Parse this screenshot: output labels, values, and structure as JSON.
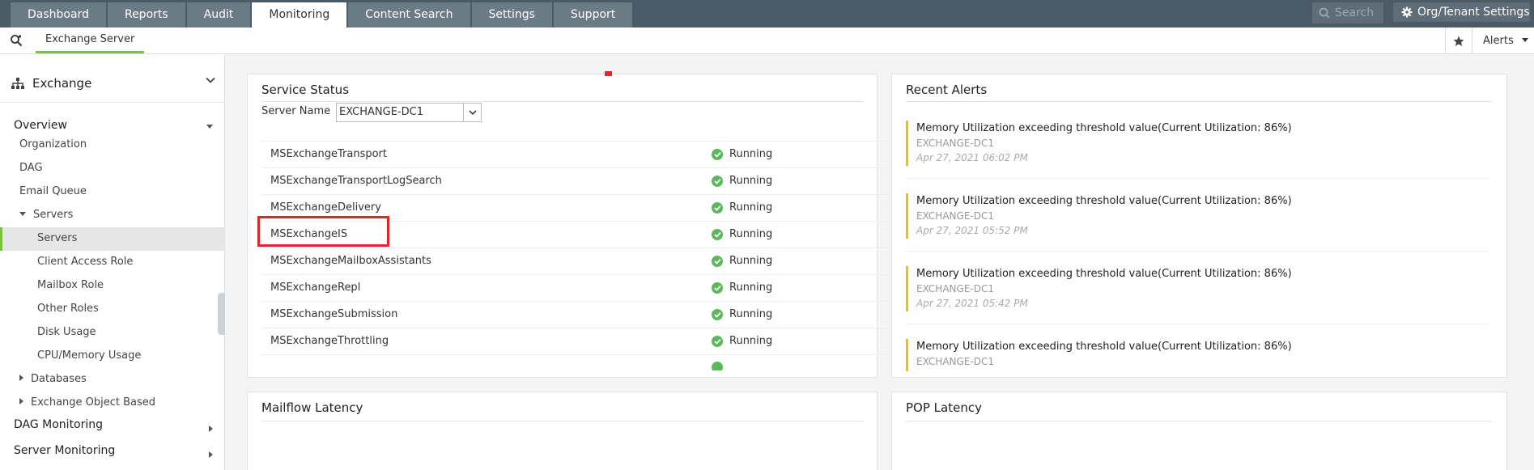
{
  "topnav": {
    "tabs": [
      "Dashboard",
      "Reports",
      "Audit",
      "Monitoring",
      "Content Search",
      "Settings",
      "Support"
    ],
    "active_tab": "Monitoring",
    "search_placeholder": "Search",
    "org_settings_label": "Org/Tenant Settings"
  },
  "subnav": {
    "tab_label": "Exchange Server",
    "alerts_label": "Alerts"
  },
  "sidebar": {
    "heading": "Exchange",
    "overview": "Overview",
    "items": {
      "organization": "Organization",
      "dag": "DAG",
      "email_queue": "Email Queue",
      "servers_group": "Servers",
      "servers": "Servers",
      "client_access_role": "Client Access Role",
      "mailbox_role": "Mailbox Role",
      "other_roles": "Other Roles",
      "disk_usage": "Disk Usage",
      "cpu_memory_usage": "CPU/Memory Usage",
      "databases": "Databases",
      "exchange_object_based": "Exchange Object Based",
      "dag_monitoring": "DAG Monitoring",
      "server_monitoring": "Server Monitoring"
    }
  },
  "service_status": {
    "title": "Service Status",
    "server_name_label": "Server Name",
    "server_name_value": "EXCHANGE-DC1",
    "rows": [
      {
        "name": "MSExchangeTransport",
        "status": "Running"
      },
      {
        "name": "MSExchangeTransportLogSearch",
        "status": "Running"
      },
      {
        "name": "MSExchangeDelivery",
        "status": "Running"
      },
      {
        "name": "MSExchangeIS",
        "status": "Running"
      },
      {
        "name": "MSExchangeMailboxAssistants",
        "status": "Running"
      },
      {
        "name": "MSExchangeRepl",
        "status": "Running"
      },
      {
        "name": "MSExchangeSubmission",
        "status": "Running"
      },
      {
        "name": "MSExchangeThrottling",
        "status": "Running"
      }
    ]
  },
  "recent_alerts": {
    "title": "Recent Alerts",
    "alerts": [
      {
        "message": "Memory Utilization exceeding threshold value(Current Utilization: 86%)",
        "server": "EXCHANGE-DC1",
        "time": "Apr 27, 2021 06:02 PM"
      },
      {
        "message": "Memory Utilization exceeding threshold value(Current Utilization: 86%)",
        "server": "EXCHANGE-DC1",
        "time": "Apr 27, 2021 05:52 PM"
      },
      {
        "message": "Memory Utilization exceeding threshold value(Current Utilization: 86%)",
        "server": "EXCHANGE-DC1",
        "time": "Apr 27, 2021 05:42 PM"
      },
      {
        "message": "Memory Utilization exceeding threshold value(Current Utilization: 86%)",
        "server": "EXCHANGE-DC1",
        "time": ""
      }
    ]
  },
  "mailflow_latency": {
    "title": "Mailflow Latency"
  },
  "pop_latency": {
    "title": "POP Latency"
  },
  "colors": {
    "accent_green": "#7cc142",
    "alert_yellow": "#f2c200",
    "highlight_red": "#e0262b",
    "running_green": "#5cb85c"
  }
}
